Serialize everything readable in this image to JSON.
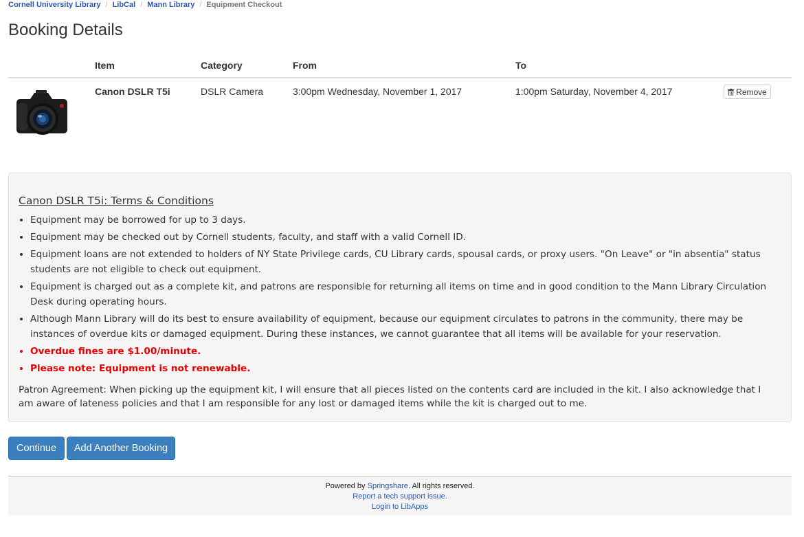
{
  "breadcrumb": {
    "items": [
      "Cornell University Library",
      "LibCal",
      "Mann Library"
    ],
    "current": "Equipment Checkout"
  },
  "page_title": "Booking Details",
  "table": {
    "headers": {
      "item": "Item",
      "category": "Category",
      "from": "From",
      "to": "To"
    },
    "row": {
      "item": "Canon DSLR T5i",
      "category": "DSLR Camera",
      "from": "3:00pm Wednesday, November 1, 2017",
      "to": "1:00pm Saturday, November 4, 2017",
      "remove_label": "Remove",
      "image": "camera-photo"
    }
  },
  "terms": {
    "title": "Canon DSLR T5i: Terms & Conditions",
    "items": [
      "Equipment may be borrowed for up to 3 days.",
      "Equipment may be checked out by Cornell students, faculty, and staff with a valid Cornell ID.",
      "Equipment loans are not extended to holders of NY State Privilege cards, CU Library cards, spousal cards, or proxy users. \"On Leave\" or \"in absentia\" status students are not eligible to check out equipment.",
      "Equipment is charged out as a complete kit, and patrons are responsible for returning all items on time and in good condition to the Mann Library Circulation Desk during operating hours.",
      "Although Mann Library will do its best to ensure availability of equipment, because our equipment circulates to patrons in the community, there may be instances of overdue kits or damaged equipment. During these instances, we cannot guarantee that all items will be available for your reservation."
    ],
    "warnings": [
      "Overdue fines are $1.00/minute.",
      "Please note: Equipment is not renewable."
    ],
    "agreement": "Patron Agreement: When picking up the equipment kit, I will ensure that all pieces listed on the contents card are included in the kit. I also acknowledge that I am aware of lateness policies and that I am responsible for any lost or damaged items while the kit is charged out to me."
  },
  "buttons": {
    "continue": "Continue",
    "add_booking": "Add Another Booking"
  },
  "footer": {
    "powered_prefix": "Powered by ",
    "powered_link": "Springshare",
    "powered_suffix": ". All rights reserved.",
    "support_link": "Report a tech support issue.",
    "login_link": "Login to LibApps"
  },
  "colors": {
    "link": "#2b58ae",
    "primary_button": "#3a7fbf",
    "warning_text": "#e60000",
    "well_background": "#f5f5f5"
  }
}
